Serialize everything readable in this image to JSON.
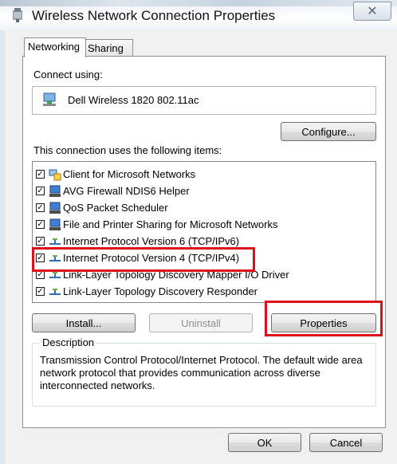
{
  "window": {
    "title": "Wireless Network Connection Properties",
    "close_glyph": "✕"
  },
  "tabs": [
    {
      "label": "Networking",
      "active": true
    },
    {
      "label": "Sharing",
      "active": false
    }
  ],
  "connect_using": {
    "label": "Connect using:",
    "adapter_name": "Dell Wireless 1820 802.11ac",
    "adapter_icon": "network-adapter-icon"
  },
  "buttons": {
    "configure": "Configure...",
    "install": "Install...",
    "uninstall": "Uninstall",
    "properties": "Properties",
    "ok": "OK",
    "cancel": "Cancel"
  },
  "items_label": "This connection uses the following items:",
  "items": [
    {
      "label": "Client for Microsoft Networks",
      "checked": true,
      "icon": "client-network-icon"
    },
    {
      "label": "AVG Firewall NDIS6 Helper",
      "checked": true,
      "icon": "service-icon"
    },
    {
      "label": "QoS Packet Scheduler",
      "checked": true,
      "icon": "service-icon"
    },
    {
      "label": "File and Printer Sharing for Microsoft Networks",
      "checked": true,
      "icon": "service-icon"
    },
    {
      "label": "Internet Protocol Version 6 (TCP/IPv6)",
      "checked": true,
      "icon": "protocol-icon"
    },
    {
      "label": "Internet Protocol Version 4 (TCP/IPv4)",
      "checked": true,
      "icon": "protocol-icon"
    },
    {
      "label": "Link-Layer Topology Discovery Mapper I/O Driver",
      "checked": true,
      "icon": "protocol-icon"
    },
    {
      "label": "Link-Layer Topology Discovery Responder",
      "checked": true,
      "icon": "protocol-icon"
    }
  ],
  "description": {
    "title": "Description",
    "text": "Transmission Control Protocol/Internet Protocol. The default wide area network protocol that provides communication across diverse interconnected networks."
  },
  "colors": {
    "highlight": "#e0101a",
    "protocol_icon": "#2e6fb7"
  }
}
